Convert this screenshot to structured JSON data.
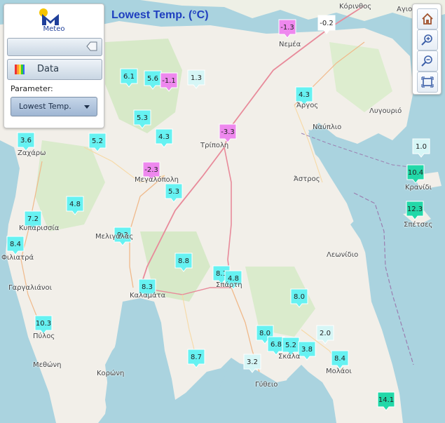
{
  "title": "Lowest Temp. (°C)",
  "panel": {
    "logo_text": "Meteo",
    "data_label": "Data",
    "parameter_label": "Parameter:",
    "parameter_value": "Lowest Temp."
  },
  "colors": {
    "cold": "#ee88ee",
    "mild": "#66f2f2",
    "warm": "#22d8a8",
    "marker_text": "#222222",
    "title": "#1f3fbf"
  },
  "icons": [
    "logo-icon",
    "slider-handle-icon",
    "rainbow-icon",
    "home-icon",
    "zoom-in-icon",
    "zoom-out-icon",
    "fullscreen-icon"
  ],
  "places": [
    {
      "name": "Κόρινθος"
    },
    {
      "name": "Νεμέα"
    },
    {
      "name": "Άργος"
    },
    {
      "name": "Λυγουριό"
    },
    {
      "name": "Ναύπλιο"
    },
    {
      "name": "Τρίπολη"
    },
    {
      "name": "Άστρος"
    },
    {
      "name": "Κρανίδι"
    },
    {
      "name": "Σπέτσες"
    },
    {
      "name": "Ζαχάρω"
    },
    {
      "name": "Κυπαρισσία"
    },
    {
      "name": "Φιλιατρά"
    },
    {
      "name": "Γαργαλιάνοι"
    },
    {
      "name": "Πύλος"
    },
    {
      "name": "Μεθώνη"
    },
    {
      "name": "Κορώνη"
    },
    {
      "name": "Καλαμάτα"
    },
    {
      "name": "Σπάρτη"
    },
    {
      "name": "Γύθειο"
    },
    {
      "name": "Μολάοι"
    },
    {
      "name": "Λεωνίδιο"
    },
    {
      "name": "Μεγαλόπολη"
    },
    {
      "name": "Μελιγαλάς"
    },
    {
      "name": "Σκάλα"
    },
    {
      "name": "Αγιοι Θ."
    }
  ],
  "stations": [
    {
      "value": "-1.3",
      "cls": "cold"
    },
    {
      "value": "-0.2",
      "cls": "white"
    },
    {
      "value": "6.1",
      "cls": "mild"
    },
    {
      "value": "5.6",
      "cls": "mild"
    },
    {
      "value": "-1.1",
      "cls": "cold"
    },
    {
      "value": "1.3",
      "cls": "pale"
    },
    {
      "value": "4.3",
      "cls": "mild"
    },
    {
      "value": "5.3",
      "cls": "mild"
    },
    {
      "value": "4.3",
      "cls": "mild"
    },
    {
      "value": "-3.3",
      "cls": "cold"
    },
    {
      "value": "3.6",
      "cls": "mild"
    },
    {
      "value": "5.2",
      "cls": "mild"
    },
    {
      "value": "-2.3",
      "cls": "cold"
    },
    {
      "value": "1.0",
      "cls": "pale"
    },
    {
      "value": "5.3",
      "cls": "mild"
    },
    {
      "value": "10.4",
      "cls": "warm"
    },
    {
      "value": "4.8",
      "cls": "mild"
    },
    {
      "value": "12.3",
      "cls": "warm"
    },
    {
      "value": "7.2",
      "cls": "mild"
    },
    {
      "value": "9.3",
      "cls": "mild"
    },
    {
      "value": "8.4",
      "cls": "mild"
    },
    {
      "value": "8.8",
      "cls": "mild"
    },
    {
      "value": "8.1",
      "cls": "mild"
    },
    {
      "value": "4.8",
      "cls": "mild"
    },
    {
      "value": "8.3",
      "cls": "mild"
    },
    {
      "value": "8.0",
      "cls": "mild"
    },
    {
      "value": "10.3",
      "cls": "mild"
    },
    {
      "value": "8.0",
      "cls": "mild"
    },
    {
      "value": "2.0",
      "cls": "pale"
    },
    {
      "value": "6.8",
      "cls": "mild"
    },
    {
      "value": "5.2",
      "cls": "mild"
    },
    {
      "value": "3.8",
      "cls": "mild"
    },
    {
      "value": "8.7",
      "cls": "mild"
    },
    {
      "value": "3.2",
      "cls": "pale"
    },
    {
      "value": "8.4",
      "cls": "mild"
    },
    {
      "value": "14.1",
      "cls": "warm"
    }
  ]
}
